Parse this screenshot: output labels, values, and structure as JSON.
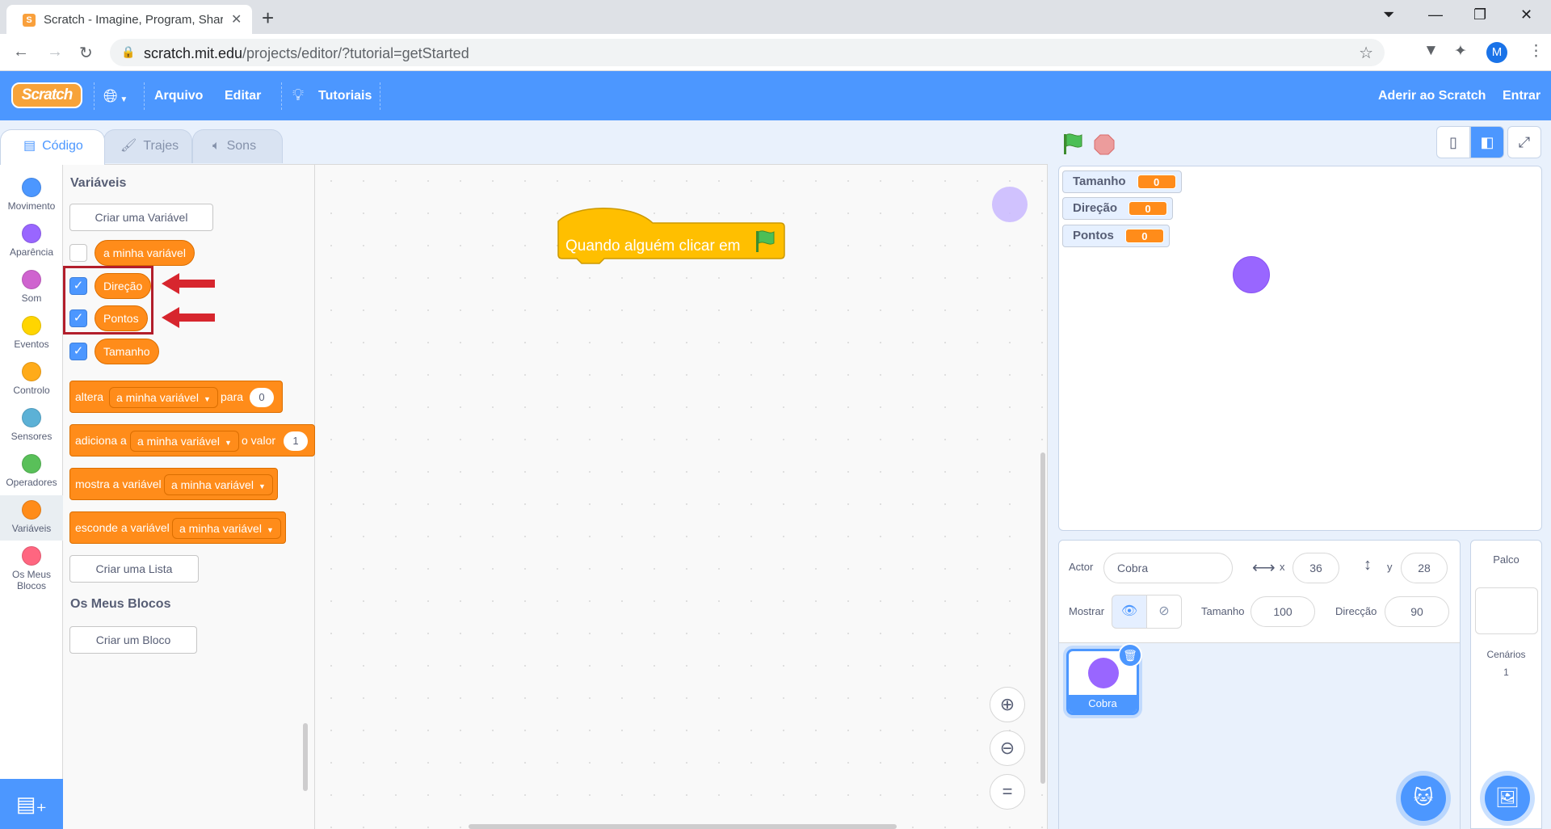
{
  "browser": {
    "tab_title": "Scratch - Imagine, Program, Share",
    "url_host": "scratch.mit.edu",
    "url_path": "/projects/editor/?tutorial=getStarted",
    "avatar_letter": "M"
  },
  "menu": {
    "logo": "Scratch",
    "file": "Arquivo",
    "edit": "Editar",
    "tutorials": "Tutoriais",
    "join": "Aderir ao Scratch",
    "signin": "Entrar"
  },
  "tabs": [
    {
      "label": "Código",
      "active": true
    },
    {
      "label": "Trajes",
      "active": false
    },
    {
      "label": "Sons",
      "active": false
    }
  ],
  "categories": [
    {
      "label": "Movimento",
      "color": "#4c97ff"
    },
    {
      "label": "Aparência",
      "color": "#9966ff"
    },
    {
      "label": "Som",
      "color": "#cf63cf"
    },
    {
      "label": "Eventos",
      "color": "#ffd500"
    },
    {
      "label": "Controlo",
      "color": "#ffab19"
    },
    {
      "label": "Sensores",
      "color": "#5cb1d6"
    },
    {
      "label": "Operadores",
      "color": "#59c059"
    },
    {
      "label": "Variáveis",
      "color": "#ff8c1a",
      "selected": true
    },
    {
      "label": "Os Meus Blocos",
      "color": "#ff6680"
    }
  ],
  "palette": {
    "heading": "Variáveis",
    "make_variable": "Criar uma Variável",
    "variables": [
      {
        "name": "a minha variável",
        "checked": false
      },
      {
        "name": "Direção",
        "checked": true
      },
      {
        "name": "Pontos",
        "checked": true
      },
      {
        "name": "Tamanho",
        "checked": true
      }
    ],
    "set_block": {
      "verb": "altera",
      "var": "a minha variável",
      "to": "para",
      "value": "0"
    },
    "change_block": {
      "verb": "adiciona a",
      "var": "a minha variável",
      "by": "o valor",
      "value": "1"
    },
    "show_block": {
      "verb": "mostra a variável",
      "var": "a minha variável"
    },
    "hide_block": {
      "verb": "esconde a variável",
      "var": "a minha variável"
    },
    "make_list": "Criar uma Lista",
    "my_blocks_heading": "Os Meus Blocos",
    "make_block": "Criar um Bloco"
  },
  "script": {
    "hat_text": "Quando alguém clicar em"
  },
  "stage": {
    "monitors": [
      {
        "label": "Tamanho",
        "value": "0"
      },
      {
        "label": "Direção",
        "value": "0"
      },
      {
        "label": "Pontos",
        "value": "0"
      }
    ]
  },
  "sprite_info": {
    "sprite_label": "Actor",
    "sprite_name": "Cobra",
    "x_label": "x",
    "x": "36",
    "y_label": "y",
    "y": "28",
    "show_label": "Mostrar",
    "size_label": "Tamanho",
    "size": "100",
    "direction_label": "Direcção",
    "direction": "90"
  },
  "sprites": [
    {
      "name": "Cobra",
      "selected": true
    }
  ],
  "stage_pane": {
    "title": "Palco",
    "backdrops_label": "Cenários",
    "backdrops_count": "1"
  },
  "colors": {
    "accent": "#4c97ff",
    "variables": "#ff8c1a",
    "events": "#ffbf00",
    "annotation": "#b21e2b"
  }
}
